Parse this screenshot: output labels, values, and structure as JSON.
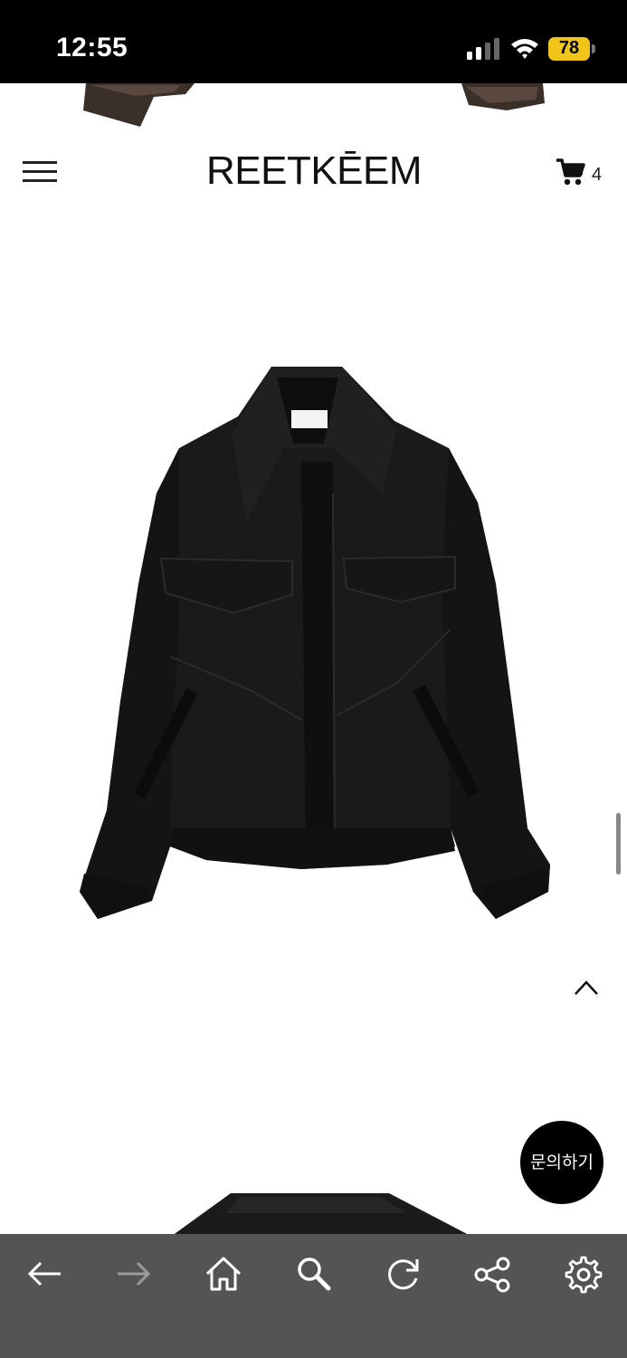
{
  "status_bar": {
    "time": "12:55",
    "battery": "78"
  },
  "header": {
    "logo": "REETKĒEM",
    "cart_count": "4"
  },
  "icons": {
    "menu": "hamburger-menu-icon",
    "cart": "shopping-cart-icon",
    "scroll_top": "chevron-up-icon",
    "back": "arrow-left-icon",
    "forward": "arrow-right-icon",
    "home": "home-icon",
    "search": "search-icon",
    "reload": "reload-icon",
    "share": "share-icon",
    "settings": "gear-icon"
  },
  "floating": {
    "inquiry_label": "문의하기"
  },
  "colors": {
    "toolbar": "#545454",
    "status_bar": "#000000",
    "battery": "#f0c419",
    "inquiry_button": "#000000"
  }
}
